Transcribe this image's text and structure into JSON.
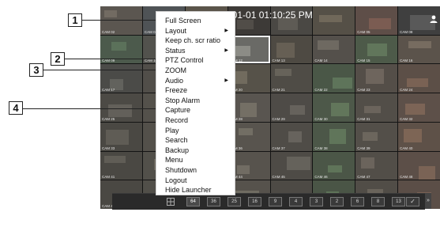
{
  "screen": {
    "datetime": "6-01-01 01:10:25 PM",
    "cameras": [
      {
        "label": "CAM 02",
        "tone": "#5b5650",
        "accent": "#8f8678"
      },
      {
        "label": "CAM 04",
        "tone": "#4f5356",
        "accent": "#7d8a96"
      },
      {
        "label": "CAM 04",
        "tone": "#5a544a",
        "accent": "#9b9079"
      },
      {
        "label": "",
        "tone": "#3d3a37",
        "accent": "#6a655d"
      },
      {
        "label": "",
        "tone": "#4a4844",
        "accent": "#77736b"
      },
      {
        "label": "",
        "tone": "#555047",
        "accent": "#928471"
      },
      {
        "label": "CAM 05",
        "tone": "#5e4e48",
        "accent": "#a06f5f"
      },
      {
        "label": "CAM 08",
        "tone": "#3f3f3f",
        "accent": "#7a7a7a"
      },
      {
        "label": "CAM 09",
        "tone": "#4c5a4c",
        "accent": "#6e8f6c"
      },
      {
        "label": "CAM 10",
        "tone": "#52524d",
        "accent": "#8a8a7e"
      },
      {
        "label": "",
        "tone": "#4a4d50",
        "accent": "#7c8186"
      },
      {
        "label": "CAM 12",
        "tone": "#6a6a66",
        "accent": "#b5b5ad"
      },
      {
        "label": "CAM 13",
        "tone": "#4e4a43",
        "accent": "#857b6a"
      },
      {
        "label": "CAM 14",
        "tone": "#54504b",
        "accent": "#8e877d"
      },
      {
        "label": "CAM 15",
        "tone": "#4d5a49",
        "accent": "#7a9970"
      },
      {
        "label": "CAM 16",
        "tone": "#5b534b",
        "accent": "#9a8b7b"
      },
      {
        "label": "CAM 17",
        "tone": "#4b4b48",
        "accent": "#7e7e78"
      },
      {
        "label": "",
        "tone": "#514e49",
        "accent": "#8a8279"
      },
      {
        "label": "",
        "tone": "#4a4740",
        "accent": "#7e7767"
      },
      {
        "label": "CAM 20",
        "tone": "#565249",
        "accent": "#928a78"
      },
      {
        "label": "CAM 21",
        "tone": "#4f4c46",
        "accent": "#868074"
      },
      {
        "label": "CAM 22",
        "tone": "#4a5747",
        "accent": "#789a70"
      },
      {
        "label": "CAM 23",
        "tone": "#544e48",
        "accent": "#8f8377"
      },
      {
        "label": "CAM 24",
        "tone": "#5c4f47",
        "accent": "#a07a64"
      },
      {
        "label": "CAM 25",
        "tone": "#4c4a45",
        "accent": "#817c73"
      },
      {
        "label": "",
        "tone": "#54514b",
        "accent": "#8d877d"
      },
      {
        "label": "",
        "tone": "#4b4944",
        "accent": "#7f7a70"
      },
      {
        "label": "CAM 28",
        "tone": "#595550",
        "accent": "#95907f"
      },
      {
        "label": "CAM 29",
        "tone": "#4e4b47",
        "accent": "#847f76"
      },
      {
        "label": "CAM 30",
        "tone": "#4d5849",
        "accent": "#7c9c72"
      },
      {
        "label": "CAM 31",
        "tone": "#524e48",
        "accent": "#8a8175"
      },
      {
        "label": "CAM 32",
        "tone": "#5d5049",
        "accent": "#a27d67"
      },
      {
        "label": "CAM 33",
        "tone": "#4a4843",
        "accent": "#7b766d"
      },
      {
        "label": "",
        "tone": "#53504a",
        "accent": "#8c867b"
      },
      {
        "label": "",
        "tone": "#4c4a44",
        "accent": "#827c71"
      },
      {
        "label": "CAM 36",
        "tone": "#58544e",
        "accent": "#938d80"
      },
      {
        "label": "CAM 37",
        "tone": "#4f4c47",
        "accent": "#858077"
      },
      {
        "label": "CAM 38",
        "tone": "#4c5748",
        "accent": "#7a9b70"
      },
      {
        "label": "CAM 39",
        "tone": "#534f49",
        "accent": "#8b8276"
      },
      {
        "label": "CAM 40",
        "tone": "#5e5148",
        "accent": "#a47f66"
      },
      {
        "label": "CAM 41",
        "tone": "#4a4843",
        "accent": "#7c776e"
      },
      {
        "label": "",
        "tone": "#52504a",
        "accent": "#8b867b"
      },
      {
        "label": "",
        "tone": "#4b4944",
        "accent": "#817b70"
      },
      {
        "label": "CAM 44",
        "tone": "#57534d",
        "accent": "#928c7f"
      },
      {
        "label": "CAM 45",
        "tone": "#4e4b46",
        "accent": "#837e75"
      },
      {
        "label": "CAM 46",
        "tone": "#4b5647",
        "accent": "#789a6f"
      },
      {
        "label": "CAM 47",
        "tone": "#524e48",
        "accent": "#8a8175"
      },
      {
        "label": "CAM 48",
        "tone": "#5c4f48",
        "accent": "#a07c65"
      },
      {
        "label": "CAM 49",
        "tone": "#4a4843",
        "accent": "#7a756c"
      },
      {
        "label": "",
        "tone": "#514f49",
        "accent": "#8a857a"
      },
      {
        "label": "",
        "tone": "#4b4943",
        "accent": "#807a6f"
      },
      {
        "label": "CAM 52",
        "tone": "#56524c",
        "accent": "#918b7e"
      },
      {
        "label": "CAM 53",
        "tone": "#4d4a45",
        "accent": "#827d74"
      },
      {
        "label": "CAM 54",
        "tone": "#4a5546",
        "accent": "#77996e"
      },
      {
        "label": "CAM 55",
        "tone": "#514d47",
        "accent": "#898074"
      },
      {
        "label": "CAM 56",
        "tone": "#5b4e47",
        "accent": "#9f7b64"
      }
    ]
  },
  "context_menu": {
    "items": [
      {
        "label": "Full Screen",
        "arrow": ""
      },
      {
        "label": "Layout",
        "arrow": "▶"
      },
      {
        "label": "Keep ch. scr ratio",
        "arrow": ""
      },
      {
        "label": "Status",
        "arrow": "▶"
      },
      {
        "label": "PTZ Control",
        "arrow": ""
      },
      {
        "label": "ZOOM",
        "arrow": ""
      },
      {
        "label": "Audio",
        "arrow": "▶"
      },
      {
        "label": "Freeze",
        "arrow": ""
      },
      {
        "label": "Stop Alarm",
        "arrow": ""
      },
      {
        "label": "Capture",
        "arrow": ""
      },
      {
        "label": "Record",
        "arrow": ""
      },
      {
        "label": "Play",
        "arrow": ""
      },
      {
        "label": "Search",
        "arrow": ""
      },
      {
        "label": "Backup",
        "arrow": ""
      },
      {
        "label": "Menu",
        "arrow": ""
      },
      {
        "label": "Shutdown",
        "arrow": ""
      },
      {
        "label": "Logout",
        "arrow": ""
      },
      {
        "label": "Hide Launcher",
        "arrow": ""
      }
    ]
  },
  "callouts": [
    "1",
    "2",
    "3",
    "4"
  ],
  "launcher": {
    "buttons": [
      "64",
      "36",
      "25",
      "16",
      "9",
      "4",
      "3",
      "2",
      "6",
      "8",
      "13"
    ],
    "check": "✓",
    "more": "»"
  }
}
